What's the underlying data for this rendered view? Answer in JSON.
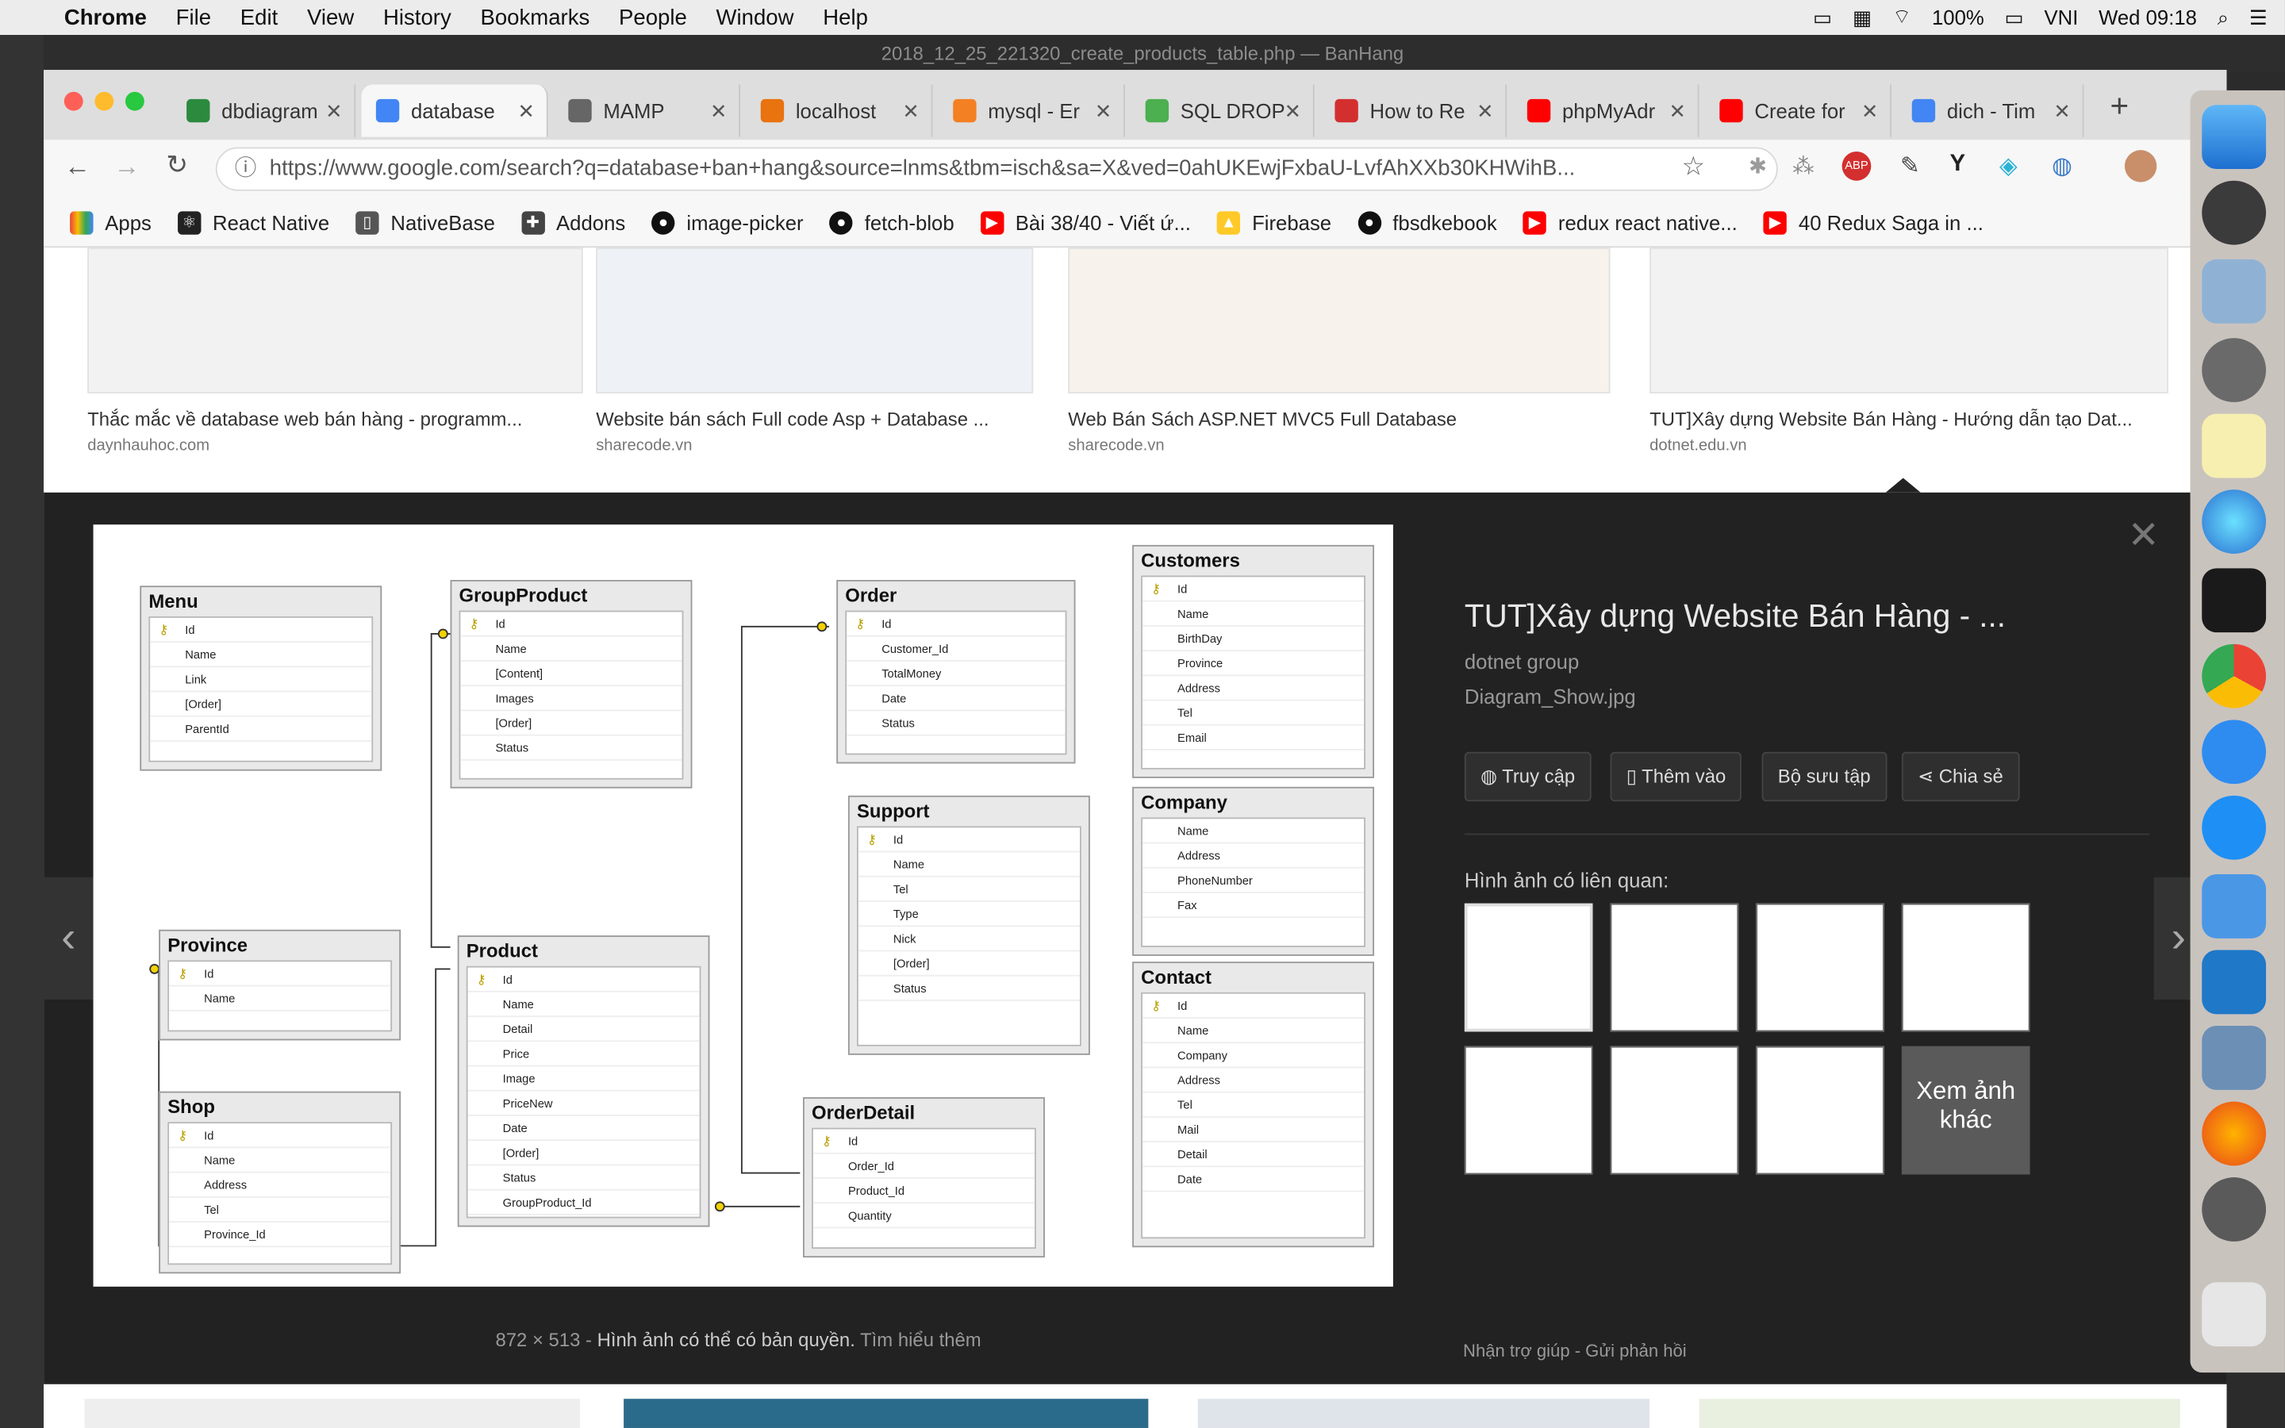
{
  "menubar": {
    "app": "Chrome",
    "items": [
      "File",
      "Edit",
      "View",
      "History",
      "Bookmarks",
      "People",
      "Window",
      "Help"
    ],
    "battery": "100%",
    "input": "VNI",
    "clock": "Wed 09:18"
  },
  "window_title": "2018_12_25_221320_create_products_table.php — BanHang",
  "tabs": [
    {
      "label": "dbdiagram",
      "color": "#2b8a3e"
    },
    {
      "label": "database",
      "color": "#4285f4"
    },
    {
      "label": "MAMP",
      "color": "#666"
    },
    {
      "label": "localhost",
      "color": "#e8730f"
    },
    {
      "label": "mysql - Er",
      "color": "#f48024"
    },
    {
      "label": "SQL DROP",
      "color": "#4caf50"
    },
    {
      "label": "How to Re",
      "color": "#d32f2f"
    },
    {
      "label": "phpMyAdr",
      "color": "#ff0000"
    },
    {
      "label": "Create for",
      "color": "#ff0000"
    },
    {
      "label": "dich - Tim",
      "color": "#4285f4"
    }
  ],
  "url": "https://www.google.com/search?q=database+ban+hang&source=lnms&tbm=isch&sa=X&ved=0ahUKEwjFxbaU-LvfAhXXb30KHWihB...",
  "bookmarks": [
    "Apps",
    "React Native",
    "NativeBase",
    "Addons",
    "image-picker",
    "fetch-blob",
    "Bài 38/40 - Viết ứ...",
    "Firebase",
    "fbsdkebook",
    "redux react native...",
    "40 Redux Saga in ..."
  ],
  "results": [
    {
      "caption": "Thắc mắc về database web bán hàng - programm...",
      "source": "daynhauhoc.com"
    },
    {
      "caption": "Website bán sách Full code Asp + Database ...",
      "source": "sharecode.vn"
    },
    {
      "caption": "Web Bán Sách ASP.NET MVC5 Full Database",
      "source": "sharecode.vn"
    },
    {
      "caption": "TUT]Xây dựng Website Bán Hàng - Hướng dẫn tạo Dat...",
      "source": "dotnet.edu.vn"
    }
  ],
  "diagram": {
    "tables": [
      {
        "name": "Menu",
        "fields": [
          "Id",
          "Name",
          "Link",
          "[Order]",
          "ParentId"
        ]
      },
      {
        "name": "GroupProduct",
        "fields": [
          "Id",
          "Name",
          "[Content]",
          "Images",
          "[Order]",
          "Status"
        ]
      },
      {
        "name": "Order",
        "fields": [
          "Id",
          "Customer_Id",
          "TotalMoney",
          "Date",
          "Status"
        ]
      },
      {
        "name": "Customers",
        "fields": [
          "Id",
          "Name",
          "BirthDay",
          "Province",
          "Address",
          "Tel",
          "Email"
        ]
      },
      {
        "name": "Support",
        "fields": [
          "Id",
          "Name",
          "Tel",
          "Type",
          "Nick",
          "[Order]",
          "Status"
        ]
      },
      {
        "name": "Company",
        "fields": [
          "Name",
          "Address",
          "PhoneNumber",
          "Fax"
        ]
      },
      {
        "name": "Province",
        "fields": [
          "Id",
          "Name"
        ]
      },
      {
        "name": "Product",
        "fields": [
          "Id",
          "Name",
          "Detail",
          "Price",
          "Image",
          "PriceNew",
          "Date",
          "[Order]",
          "Status",
          "GroupProduct_Id"
        ]
      },
      {
        "name": "Contact",
        "fields": [
          "Id",
          "Name",
          "Company",
          "Address",
          "Tel",
          "Mail",
          "Detail",
          "Date"
        ]
      },
      {
        "name": "Shop",
        "fields": [
          "Id",
          "Name",
          "Address",
          "Tel",
          "Province_Id"
        ]
      },
      {
        "name": "OrderDetail",
        "fields": [
          "Id",
          "Order_Id",
          "Product_Id",
          "Quantity"
        ]
      }
    ]
  },
  "side": {
    "title": "TUT]Xây dựng Website Bán Hàng - ...",
    "group": "dotnet group",
    "file": "Diagram_Show.jpg",
    "buttons": [
      "Truy cập",
      "Thêm vào",
      "Bộ sưu tập",
      "Chia sẻ"
    ],
    "related": "Hình ảnh có liên quan:",
    "more": "Xem ảnh khác",
    "help": "Nhận trợ giúp",
    "feedback": "Gửi phản hồi"
  },
  "footer": {
    "size": "872 × 513",
    "copyright": "Hình ảnh có thể có bản quyền.",
    "learn": "Tìm hiểu thêm"
  }
}
